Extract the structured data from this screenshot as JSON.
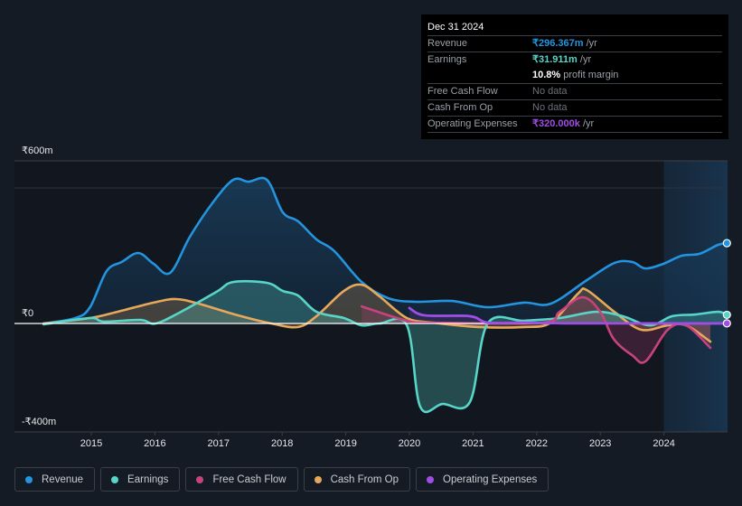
{
  "tooltip": {
    "date": "Dec 31 2024",
    "rows": [
      {
        "label": "Revenue",
        "value": "₹296.367m",
        "unit": " /yr",
        "color": "#2394df"
      },
      {
        "label": "Earnings",
        "value": "₹31.911m",
        "unit": " /yr",
        "color": "#58d5c9"
      },
      {
        "label": "",
        "value": "10.8%",
        "unit": " profit margin",
        "color": "#ffffff"
      },
      {
        "label": "Free Cash Flow",
        "value": "No data",
        "unit": "",
        "color": "#7a8089"
      },
      {
        "label": "Cash From Op",
        "value": "No data",
        "unit": "",
        "color": "#7a8089"
      },
      {
        "label": "Operating Expenses",
        "value": "₹320.000k",
        "unit": " /yr",
        "color": "#9f4ee5"
      }
    ]
  },
  "legend": [
    {
      "label": "Revenue",
      "color": "#2394df"
    },
    {
      "label": "Earnings",
      "color": "#58d5c9"
    },
    {
      "label": "Free Cash Flow",
      "color": "#c8437e"
    },
    {
      "label": "Cash From Op",
      "color": "#e8a85a"
    },
    {
      "label": "Operating Expenses",
      "color": "#9f4ee5"
    }
  ],
  "chart_data": {
    "type": "area",
    "title": "",
    "xlabel": "",
    "ylabel": "",
    "currency": "₹",
    "y_tick_labels": [
      "₹600m",
      "₹0",
      "-₹400m"
    ],
    "y_ticks": [
      600,
      0,
      -400
    ],
    "ylim": [
      -400,
      600
    ],
    "xlim": [
      2014.0,
      2025.0
    ],
    "x_tick_labels": [
      "2015",
      "2016",
      "2017",
      "2018",
      "2019",
      "2020",
      "2021",
      "2022",
      "2023",
      "2024"
    ],
    "x_ticks": [
      2015,
      2016,
      2017,
      2018,
      2019,
      2020,
      2021,
      2022,
      2023,
      2024
    ],
    "highlight_from": 2024.0,
    "grid": "horizontal",
    "series": [
      {
        "name": "Revenue",
        "color": "#2394df",
        "points": [
          [
            2014.25,
            0
          ],
          [
            2014.75,
            20
          ],
          [
            2014.98,
            60
          ],
          [
            2015.24,
            193
          ],
          [
            2015.48,
            227
          ],
          [
            2015.74,
            260
          ],
          [
            2015.98,
            220
          ],
          [
            2016.24,
            187
          ],
          [
            2016.55,
            320
          ],
          [
            2016.9,
            443
          ],
          [
            2017.23,
            530
          ],
          [
            2017.47,
            523
          ],
          [
            2017.76,
            530
          ],
          [
            2018.01,
            410
          ],
          [
            2018.25,
            377
          ],
          [
            2018.54,
            310
          ],
          [
            2018.82,
            267
          ],
          [
            2019.25,
            153
          ],
          [
            2019.67,
            93
          ],
          [
            2020.1,
            80
          ],
          [
            2020.67,
            83
          ],
          [
            2021.23,
            60
          ],
          [
            2021.8,
            77
          ],
          [
            2022.22,
            73
          ],
          [
            2022.79,
            160
          ],
          [
            2023.22,
            223
          ],
          [
            2023.5,
            227
          ],
          [
            2023.71,
            203
          ],
          [
            2023.99,
            220
          ],
          [
            2024.28,
            250
          ],
          [
            2024.56,
            257
          ],
          [
            2024.85,
            290
          ],
          [
            2024.99,
            296.4
          ]
        ]
      },
      {
        "name": "Earnings",
        "color": "#58d5c9",
        "points": [
          [
            2014.25,
            -3
          ],
          [
            2014.98,
            20
          ],
          [
            2015.2,
            7
          ],
          [
            2015.77,
            13
          ],
          [
            2016.01,
            0
          ],
          [
            2016.41,
            43
          ],
          [
            2016.97,
            117
          ],
          [
            2017.23,
            153
          ],
          [
            2017.76,
            150
          ],
          [
            2018.01,
            120
          ],
          [
            2018.25,
            103
          ],
          [
            2018.54,
            43
          ],
          [
            2018.97,
            20
          ],
          [
            2019.25,
            -7
          ],
          [
            2019.53,
            0
          ],
          [
            2019.96,
            -7
          ],
          [
            2020.17,
            -307
          ],
          [
            2020.52,
            -297
          ],
          [
            2020.95,
            -290
          ],
          [
            2021.23,
            0
          ],
          [
            2021.8,
            10
          ],
          [
            2022.36,
            20
          ],
          [
            2022.93,
            43
          ],
          [
            2023.35,
            27
          ],
          [
            2023.78,
            -7
          ],
          [
            2024.13,
            27
          ],
          [
            2024.49,
            33
          ],
          [
            2024.85,
            43
          ],
          [
            2024.99,
            31.9
          ]
        ]
      },
      {
        "name": "Free Cash Flow",
        "color": "#c8437e",
        "points": [
          [
            2019.25,
            63
          ],
          [
            2019.96,
            10
          ],
          [
            2020.38,
            3
          ],
          [
            2022.08,
            3
          ],
          [
            2022.36,
            43
          ],
          [
            2022.72,
            97
          ],
          [
            2023.0,
            43
          ],
          [
            2023.21,
            -57
          ],
          [
            2023.5,
            -117
          ],
          [
            2023.71,
            -140
          ],
          [
            2024.06,
            -23
          ],
          [
            2024.35,
            -7
          ],
          [
            2024.73,
            -90
          ]
        ]
      },
      {
        "name": "Cash From Op",
        "color": "#e8a85a",
        "points": [
          [
            2014.25,
            0
          ],
          [
            2014.98,
            20
          ],
          [
            2015.41,
            43
          ],
          [
            2015.98,
            77
          ],
          [
            2016.33,
            90
          ],
          [
            2016.69,
            73
          ],
          [
            2017.26,
            33
          ],
          [
            2017.83,
            0
          ],
          [
            2018.25,
            -13
          ],
          [
            2018.54,
            27
          ],
          [
            2018.97,
            120
          ],
          [
            2019.25,
            143
          ],
          [
            2019.53,
            100
          ],
          [
            2019.96,
            20
          ],
          [
            2020.38,
            3
          ],
          [
            2021.09,
            -13
          ],
          [
            2021.8,
            -13
          ],
          [
            2022.22,
            3
          ],
          [
            2022.65,
            110
          ],
          [
            2022.79,
            123
          ],
          [
            2023.22,
            43
          ],
          [
            2023.64,
            -23
          ],
          [
            2024.06,
            -7
          ],
          [
            2024.35,
            -7
          ],
          [
            2024.73,
            -67
          ]
        ]
      },
      {
        "name": "Operating Expenses",
        "color": "#9f4ee5",
        "points": [
          [
            2020.0,
            57
          ],
          [
            2020.24,
            30
          ],
          [
            2020.95,
            27
          ],
          [
            2021.23,
            3
          ],
          [
            2021.8,
            3
          ],
          [
            2022.5,
            0.5
          ],
          [
            2023.5,
            0.4
          ],
          [
            2024.99,
            0.32
          ]
        ]
      }
    ]
  }
}
